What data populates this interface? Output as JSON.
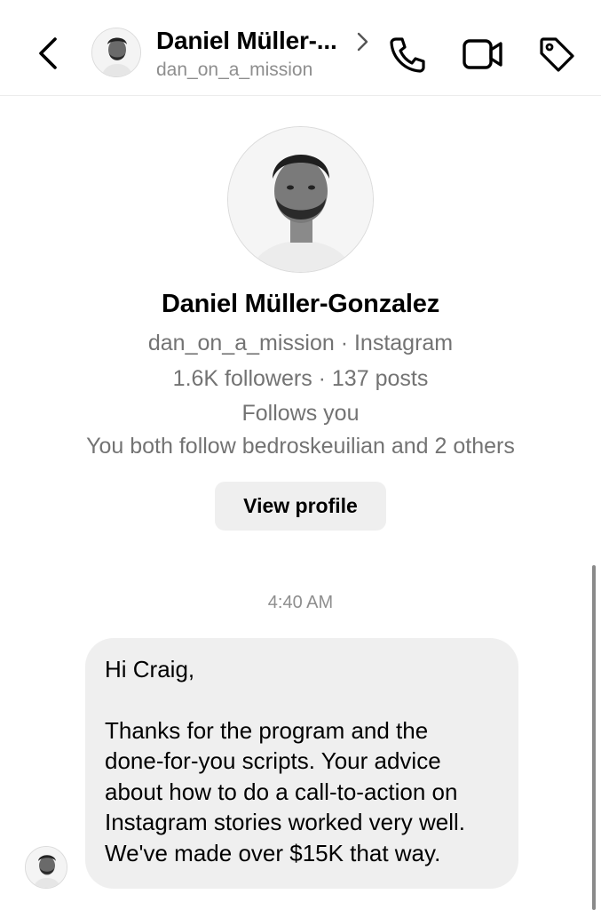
{
  "header": {
    "name": "Daniel Müller-...",
    "username": "dan_on_a_mission",
    "back_icon": "chevron-left-icon",
    "call_icon": "phone-icon",
    "video_icon": "video-camera-icon",
    "tag_icon": "tag-icon"
  },
  "profile": {
    "full_name": "Daniel Müller-Gonzalez",
    "username_platform": "dan_on_a_mission · Instagram",
    "stats": "1.6K followers · 137 posts",
    "follow_status": "Follows you",
    "mutual": "You both follow bedroskeuilian and 2 others",
    "view_profile_label": "View profile"
  },
  "conversation": {
    "timestamp": "4:40 AM",
    "messages": [
      {
        "lines": [
          "Hi Craig,",
          "",
          "Thanks for the program and the",
          "done-for-you scripts. Your advice",
          "about how to do a call-to-action on",
          "Instagram stories worked very well.",
          "We've made over $15K that way."
        ]
      }
    ]
  },
  "colors": {
    "secondary_text": "#737373",
    "muted_text": "#8e8e8e",
    "bubble_bg": "#efefef",
    "button_bg": "#efefef"
  }
}
